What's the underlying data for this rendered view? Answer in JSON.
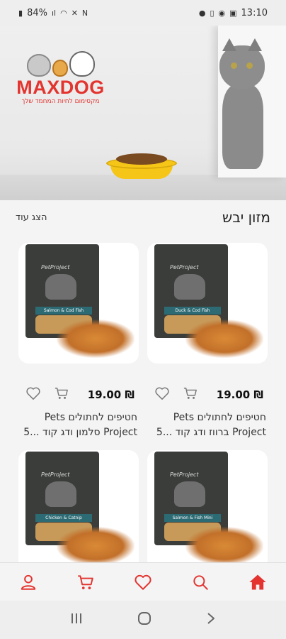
{
  "status_bar": {
    "battery": "84%",
    "time": "13:10"
  },
  "banner": {
    "logo_text": "MAXDOG",
    "logo_tagline": "מקסימום לחיות המחמד שלך"
  },
  "section": {
    "title": "מזון יבש",
    "show_more": "הצג עוד"
  },
  "products": [
    {
      "price": "19.00 ₪",
      "title_line1": "חטיפים לחתולים Pets",
      "title_line2": "Project ברווז ודג קוד ...5",
      "package_label": "Duck & Cod Fish",
      "brand": "PetProject"
    },
    {
      "price": "19.00 ₪",
      "title_line1": "חטיפים לחתולים Pets",
      "title_line2": "Project סלמון ודג קוד ...5",
      "package_label": "Salmon & Cod Fish",
      "brand": "PetProject"
    },
    {
      "package_label": "Salmon & Fish Mini",
      "brand": "PetProject"
    },
    {
      "package_label": "Chicken & Catnip",
      "brand": "PetProject"
    }
  ],
  "bottom_nav": {
    "items": [
      "home-icon",
      "search-icon",
      "heart-icon",
      "cart-icon",
      "user-icon"
    ],
    "accent_color": "#e3342f"
  },
  "system_nav": [
    "recent-apps-icon",
    "home-circle-icon",
    "back-icon"
  ]
}
